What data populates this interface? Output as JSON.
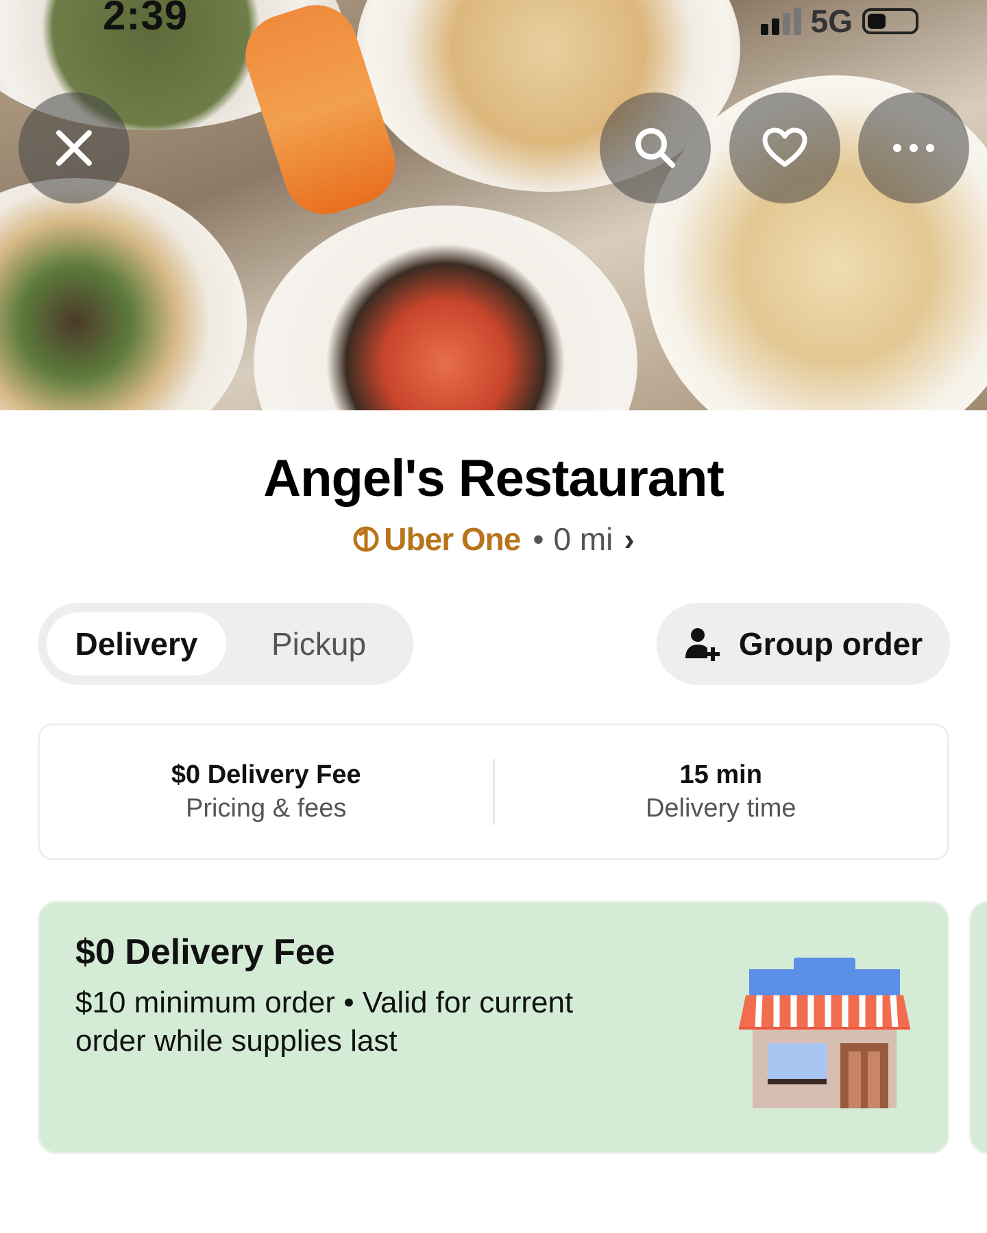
{
  "status_bar": {
    "time": "2:39",
    "network": "5G",
    "battery_level": 0.4
  },
  "header": {
    "close_icon": "close-icon",
    "search_icon": "search-icon",
    "favorite_icon": "heart-icon",
    "more_icon": "more-icon"
  },
  "restaurant": {
    "name": "Angel's Restaurant",
    "membership": "Uber One",
    "separator": "•",
    "distance": "0 mi",
    "chevron": "›"
  },
  "order_mode": {
    "options": [
      "Delivery",
      "Pickup"
    ],
    "selected": "Delivery"
  },
  "group_order": {
    "label": "Group order",
    "icon": "add-person-icon"
  },
  "info": {
    "fee": {
      "value": "$0 Delivery Fee",
      "label": "Pricing & fees"
    },
    "time": {
      "value": "15 min",
      "label": "Delivery time"
    }
  },
  "promo": {
    "title": "$0 Delivery Fee",
    "description": "$10 minimum order • Valid for current order while supplies last",
    "icon": "store-icon"
  },
  "colors": {
    "brand_gold": "#b8741a",
    "promo_bg": "#d4ecd6",
    "pill_bg": "#eeeeee"
  }
}
